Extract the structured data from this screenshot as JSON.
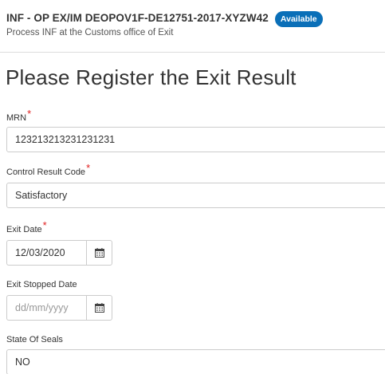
{
  "header": {
    "title": "INF - OP EX/IM DEOPOV1F-DE12751-2017-XYZW42",
    "status": "Available",
    "subtitle": "Process INF at the Customs office of Exit"
  },
  "form": {
    "title": "Please Register the Exit Result",
    "mrn": {
      "label": "MRN",
      "required": "*",
      "value": "123213213231231231"
    },
    "control_result_code": {
      "label": "Control Result Code",
      "required": "*",
      "value": "Satisfactory"
    },
    "exit_date": {
      "label": "Exit Date",
      "required": "*",
      "value": "12/03/2020",
      "icon": "calendar-icon"
    },
    "exit_stopped_date": {
      "label": "Exit Stopped Date",
      "placeholder": "dd/mm/yyyy",
      "icon": "calendar-icon"
    },
    "state_of_seals": {
      "label": "State Of Seals",
      "value": "NO"
    }
  },
  "colors": {
    "badge": "#0a6fb8",
    "required": "#e02020",
    "border": "#cccccc"
  }
}
